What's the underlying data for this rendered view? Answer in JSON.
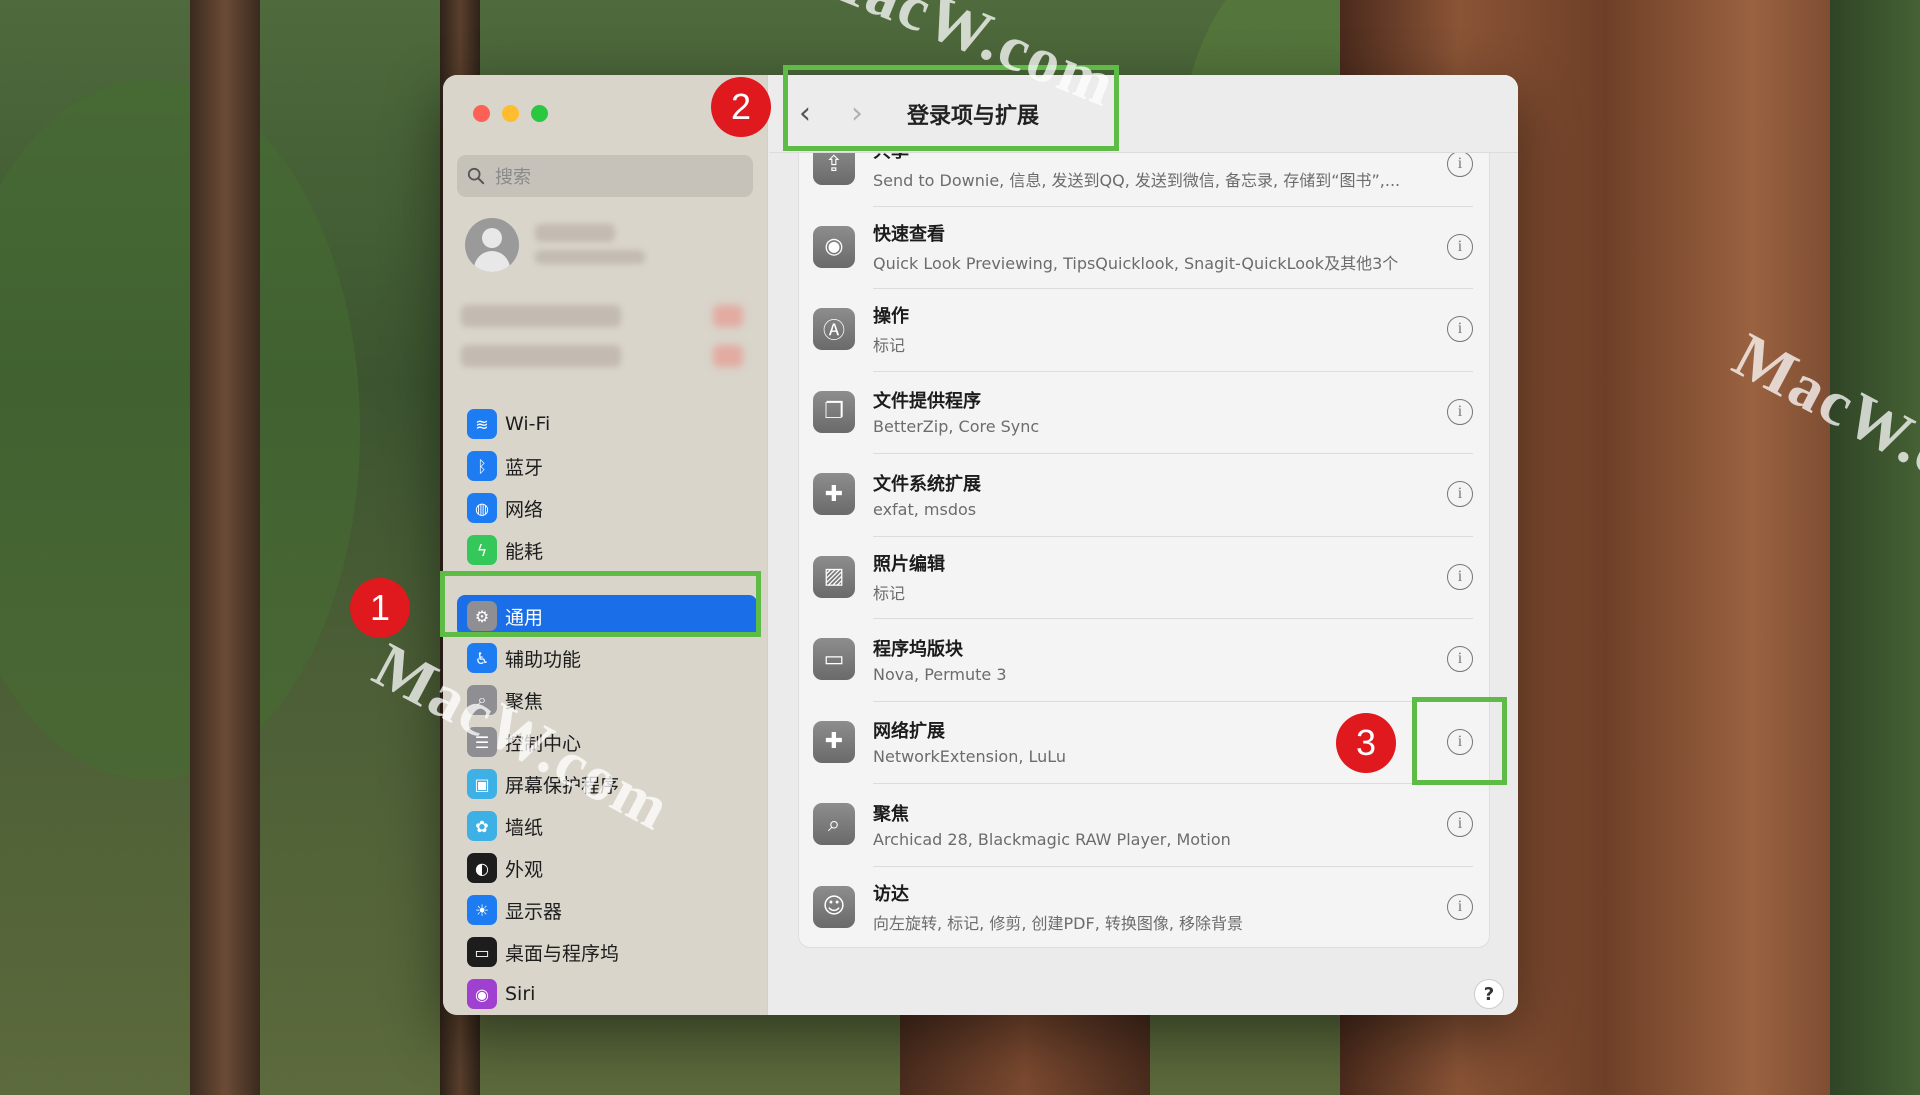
{
  "window": {
    "title": "登录项与扩展",
    "search_placeholder": "搜索"
  },
  "sidebar": {
    "items": [
      {
        "label": "Wi-Fi",
        "icon": "wifi-icon",
        "color": "#1e7cf2"
      },
      {
        "label": "蓝牙",
        "icon": "bluetooth-icon",
        "color": "#1e7cf2"
      },
      {
        "label": "网络",
        "icon": "globe-icon",
        "color": "#1e7cf2"
      },
      {
        "label": "能耗",
        "icon": "battery-icon",
        "color": "#34c759"
      },
      {
        "label": "通用",
        "icon": "gear-icon",
        "color": "#8e8e93",
        "active": true
      },
      {
        "label": "辅助功能",
        "icon": "accessibility-icon",
        "color": "#1e7cf2"
      },
      {
        "label": "聚焦",
        "icon": "search-icon",
        "color": "#8e8e93"
      },
      {
        "label": "控制中心",
        "icon": "control-center-icon",
        "color": "#8e8e93"
      },
      {
        "label": "屏幕保护程序",
        "icon": "screensaver-icon",
        "color": "#3db0e6"
      },
      {
        "label": "墙纸",
        "icon": "wallpaper-icon",
        "color": "#3db0e6"
      },
      {
        "label": "外观",
        "icon": "appearance-icon",
        "color": "#1d1d1d"
      },
      {
        "label": "显示器",
        "icon": "display-icon",
        "color": "#1e7cf2"
      },
      {
        "label": "桌面与程序坞",
        "icon": "dock-icon",
        "color": "#1d1d1d"
      },
      {
        "label": "Siri",
        "icon": "siri-icon",
        "color": "#a040d0"
      }
    ]
  },
  "extensions": [
    {
      "title": "共享",
      "subtitle": "Send to Downie, 信息, 发送到QQ, 发送到微信, 备忘录, 存储到“图书”,...",
      "icon": "share-icon"
    },
    {
      "title": "快速查看",
      "subtitle": "Quick Look Previewing, TipsQuicklook, Snagit-QuickLook及其他3个",
      "icon": "eye-icon"
    },
    {
      "title": "操作",
      "subtitle": "标记",
      "icon": "markup-icon"
    },
    {
      "title": "文件提供程序",
      "subtitle": "BetterZip, Core Sync",
      "icon": "files-icon"
    },
    {
      "title": "文件系统扩展",
      "subtitle": "exfat, msdos",
      "icon": "puzzle-icon"
    },
    {
      "title": "照片编辑",
      "subtitle": "标记",
      "icon": "photo-icon"
    },
    {
      "title": "程序坞版块",
      "subtitle": "Nova, Permute 3",
      "icon": "dock-tile-icon"
    },
    {
      "title": "网络扩展",
      "subtitle": "NetworkExtension, LuLu",
      "icon": "puzzle-icon"
    },
    {
      "title": "聚焦",
      "subtitle": "Archicad 28, Blackmagic RAW Player, Motion",
      "icon": "search-icon"
    },
    {
      "title": "访达",
      "subtitle": "向左旋转, 标记, 修剪, 创建PDF, 转换图像, 移除背景",
      "icon": "finder-icon"
    }
  ],
  "help": "?",
  "annotations": {
    "badge1": "1",
    "badge2": "2",
    "badge3": "3"
  },
  "watermark": "MacW.com",
  "colors": {
    "accent": "#1a6ee8",
    "callout": "#5dbb46",
    "badge": "#e0191e"
  }
}
